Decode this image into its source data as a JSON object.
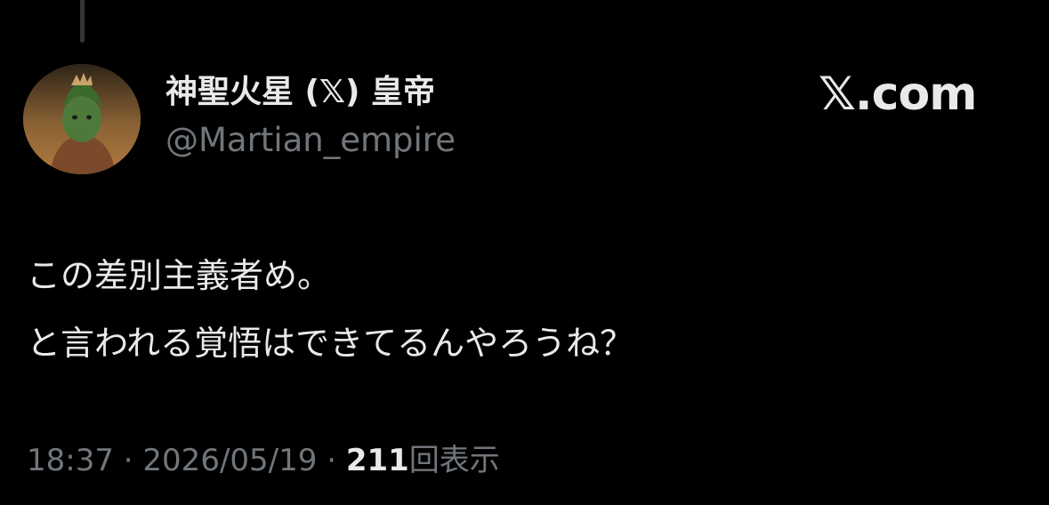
{
  "post": {
    "display_name": "神聖火星 (𝕏) 皇帝",
    "handle": "@Martian_empire",
    "brand": "𝕏.com",
    "text_lines": [
      "この差別主義者め。",
      "と言われる覚悟はできてるんやろうね？"
    ],
    "time": "18:37",
    "separator": "·",
    "date": "2026/05/19",
    "view_count": "211",
    "view_label": "回表示"
  },
  "avatar": {
    "icon": "profile-avatar",
    "colors": {
      "background_top": "#2f2418",
      "background_bottom": "#b07b3e",
      "subject": "#4d7a3a"
    }
  },
  "theme": {
    "background": "#000000",
    "primary_text": "#e7e9ea",
    "secondary_text": "#71767b",
    "thread_line": "#333639"
  }
}
